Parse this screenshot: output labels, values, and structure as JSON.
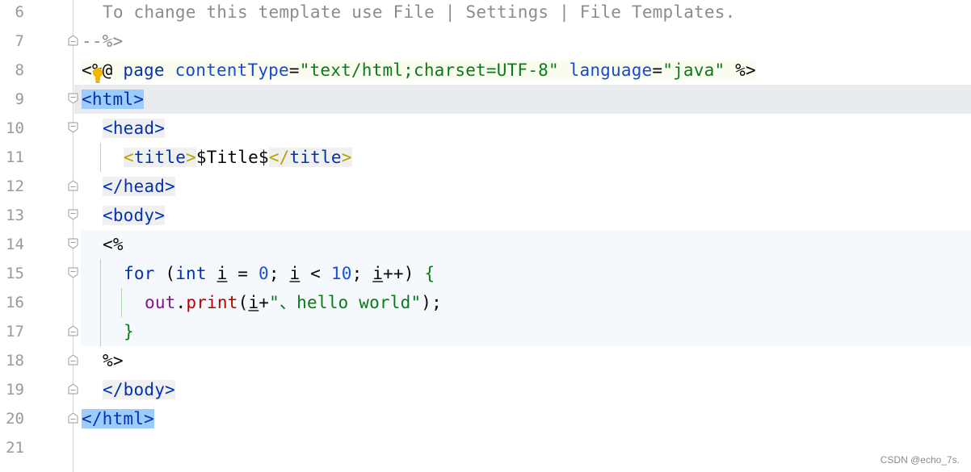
{
  "lines": [
    {
      "num": "6"
    },
    {
      "num": "7"
    },
    {
      "num": "8"
    },
    {
      "num": "9"
    },
    {
      "num": "10"
    },
    {
      "num": "11"
    },
    {
      "num": "12"
    },
    {
      "num": "13"
    },
    {
      "num": "14"
    },
    {
      "num": "15"
    },
    {
      "num": "16"
    },
    {
      "num": "17"
    },
    {
      "num": "18"
    },
    {
      "num": "19"
    },
    {
      "num": "20"
    },
    {
      "num": "21"
    }
  ],
  "code": {
    "l6_comment": "To change this template use File | Settings | File Templates.",
    "l7_end": "--%>",
    "l8_open": "<%@",
    "l8_page": " page ",
    "l8_attr1": "contentType",
    "l8_eq1": "=",
    "l8_val1": "\"text/html;charset=UTF-8\"",
    "l8_attr2": "language",
    "l8_eq2": "=",
    "l8_val2": "\"java\"",
    "l8_close": " %>",
    "l9_tag": "<html>",
    "l10_tag": "<head>",
    "l11_open_lt": "<",
    "l11_open": "title",
    "l11_open_gt": ">",
    "l11_text": "$Title$",
    "l11_close_lt": "</",
    "l11_close": "title",
    "l11_close_gt": ">",
    "l12_tag": "</head>",
    "l13_tag": "<body>",
    "l14_scriptlet": "<%",
    "l15_for": "for",
    "l15_paren": " (",
    "l15_int": "int",
    "l15_i1": "i",
    "l15_assign": " = ",
    "l15_zero": "0",
    "l15_semi1": "; ",
    "l15_i2": "i",
    "l15_lt": " < ",
    "l15_ten": "10",
    "l15_semi2": "; ",
    "l15_i3": "i",
    "l15_inc": "++) ",
    "l15_brace": "{",
    "l16_out": "out",
    "l16_dot": ".",
    "l16_print": "print",
    "l16_paren": "(",
    "l16_i": "i",
    "l16_plus": "+",
    "l16_str": "\"、hello world\"",
    "l16_end": ");",
    "l17_brace": "}",
    "l18_end": "%>",
    "l19_tag": "</body>",
    "l20_tag": "</html>"
  },
  "watermark": "CSDN @echo_7s.",
  "colors": {
    "current_line": "#e8ecef",
    "tag_highlight": "#9dccfc",
    "tag": "#0033b3",
    "string": "#067d17",
    "comment": "#8c8c8c",
    "number": "#1750eb",
    "method": "#bc0000",
    "variable": "#871094"
  },
  "icons": [
    "fold-marker-icon",
    "lightbulb-icon"
  ]
}
